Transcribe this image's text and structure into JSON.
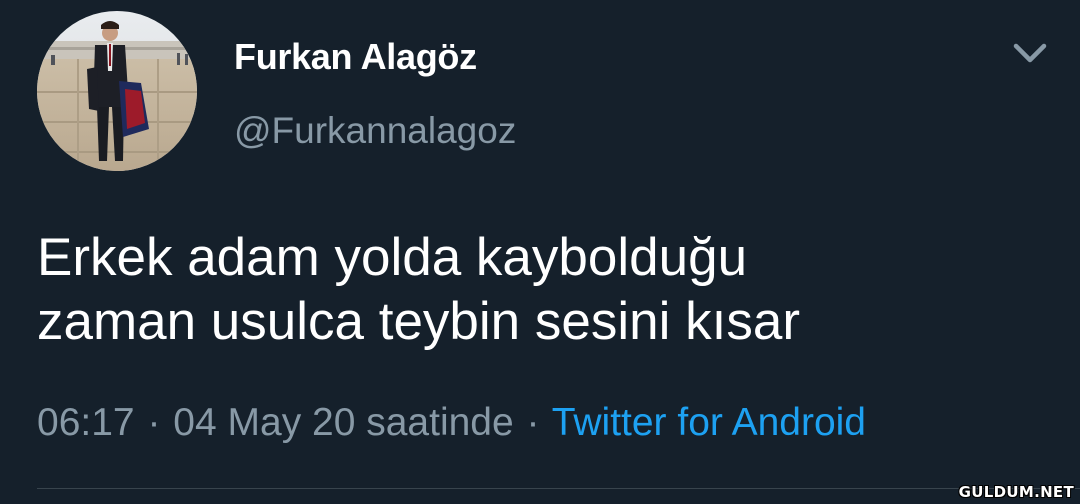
{
  "user": {
    "display_name": "Furkan Alagöz",
    "handle": "@Furkannalagoz",
    "avatar": "profile-photo"
  },
  "tweet": {
    "text_lines": [
      "Erkek adam yolda kaybolduğu",
      "zaman usulca teybin sesini kısar"
    ],
    "time": "06:17",
    "separator": "·",
    "date": "04 May 20 saatinde",
    "source": "Twitter for Android"
  },
  "icons": {
    "menu": "chevron-down-icon"
  },
  "watermark": "GULDUM.NET",
  "colors": {
    "background": "#15202b",
    "primary_text": "#ffffff",
    "secondary_text": "#8899a6",
    "link": "#1da1f2"
  }
}
